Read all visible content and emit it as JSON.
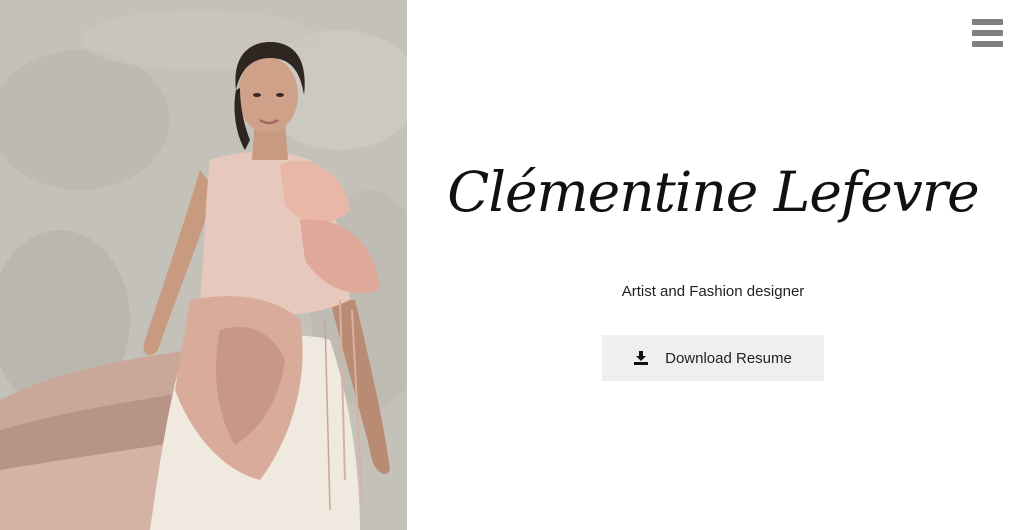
{
  "profile": {
    "name": "Clémentine Lefevre",
    "subtitle": "Artist and Fashion designer"
  },
  "actions": {
    "download_label": "Download Resume",
    "download_icon": "download-icon",
    "menu_icon": "hamburger-menu-icon"
  },
  "hero_image": {
    "subject": "photo"
  },
  "colors": {
    "menu_icon": "#808080",
    "button_bg": "#efefef",
    "text": "#222222"
  }
}
